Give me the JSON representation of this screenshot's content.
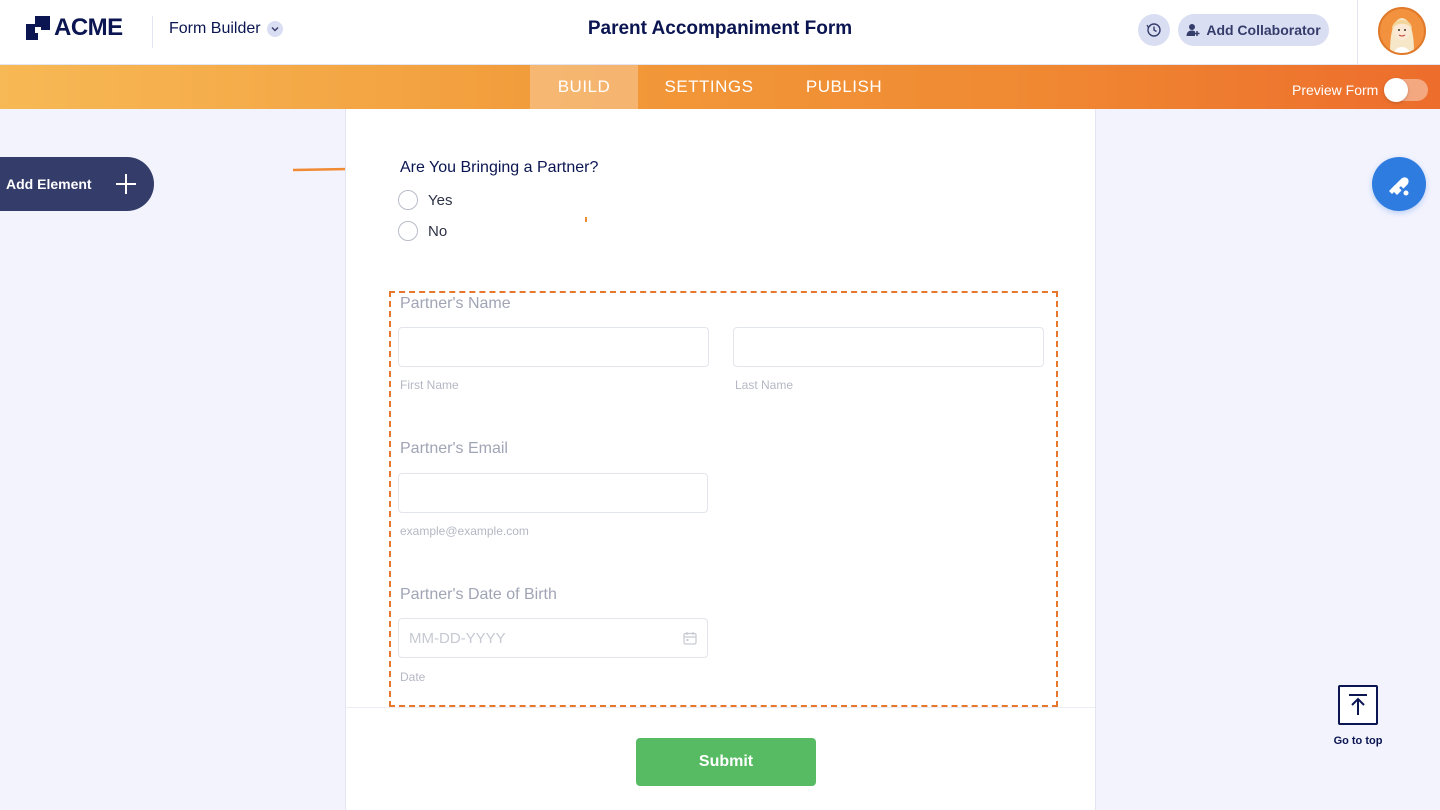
{
  "header": {
    "logo_text": "ACME",
    "builder_label": "Form Builder",
    "form_title": "Parent Accompaniment Form",
    "collaborator_label": "Add Collaborator"
  },
  "nav": {
    "tabs": [
      {
        "label": "BUILD",
        "active": true
      },
      {
        "label": "SETTINGS",
        "active": false
      },
      {
        "label": "PUBLISH",
        "active": false
      }
    ],
    "preview_label": "Preview Form",
    "preview_enabled": false
  },
  "sidebar": {
    "add_element_label": "Add Element"
  },
  "form": {
    "question": "Are You Bringing a Partner?",
    "options": [
      "Yes",
      "No"
    ],
    "partner_name": {
      "label": "Partner's Name",
      "first_sublabel": "First Name",
      "last_sublabel": "Last Name"
    },
    "partner_email": {
      "label": "Partner's Email",
      "sublabel": "example@example.com"
    },
    "partner_dob": {
      "label": "Partner's Date of Birth",
      "placeholder": "MM-DD-YYYY",
      "sublabel": "Date"
    },
    "submit_label": "Submit"
  },
  "right": {
    "goto_top_label": "Go to top"
  },
  "colors": {
    "accent_orange": "#f08a33",
    "navy": "#0a1551",
    "submit_green": "#57bb64",
    "designer_blue": "#2f7ce0"
  }
}
